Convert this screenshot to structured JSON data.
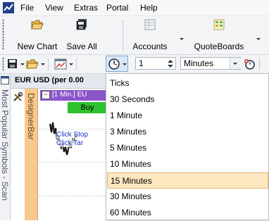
{
  "menubar": {
    "items": [
      "File",
      "View",
      "Extras",
      "Portal",
      "Help"
    ]
  },
  "toolbar": {
    "new_chart": "New Chart",
    "save_all": "Save All",
    "accounts": "Accounts",
    "quoteboards": "QuoteBoards"
  },
  "interval_bar": {
    "count_value": "1",
    "unit_value": "Minutes"
  },
  "sidebar": {
    "vertical_tab": "Most Popular Symbols - Scan"
  },
  "chart": {
    "title": "EUR USD (per 0.00",
    "panel_title": "[1 Min.] EU",
    "designer_bar": "DesignerBar",
    "buy_label": "Buy",
    "order_hint_1": "Click Stop",
    "order_hint_2": "Click Tar"
  },
  "dropdown": {
    "options": [
      "Ticks",
      "30 Seconds",
      "1 Minute",
      "3 Minutes",
      "5 Minutes",
      "10 Minutes",
      "15 Minutes",
      "30 Minutes",
      "60 Minutes"
    ],
    "selected": "15 Minutes"
  },
  "colors": {
    "accent_orange": "#f7c98f",
    "buy_green": "#2fc22f",
    "panel_purple": "#8a55c9",
    "selected_highlight": "#fde7c0"
  }
}
